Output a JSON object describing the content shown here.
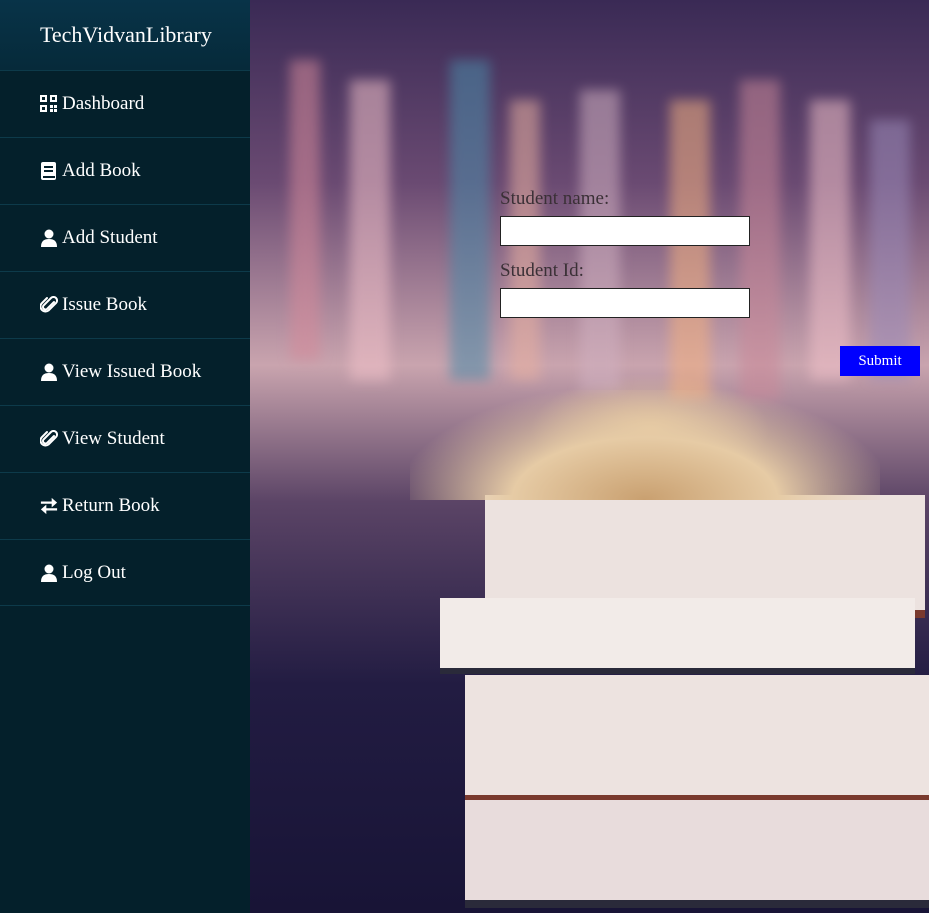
{
  "brand": {
    "title": "TechVidvanLibrary"
  },
  "sidebar": {
    "items": [
      {
        "label": "Dashboard",
        "icon": "dashboard-icon"
      },
      {
        "label": "Add Book",
        "icon": "book-icon"
      },
      {
        "label": "Add Student",
        "icon": "user-icon"
      },
      {
        "label": "Issue Book",
        "icon": "paperclip-icon"
      },
      {
        "label": "View Issued Book",
        "icon": "user-icon"
      },
      {
        "label": "View Student",
        "icon": "paperclip-icon"
      },
      {
        "label": "Return Book",
        "icon": "exchange-icon"
      },
      {
        "label": "Log Out",
        "icon": "user-icon"
      }
    ]
  },
  "form": {
    "student_name_label": "Student name:",
    "student_name_value": "",
    "student_id_label": "Student Id:",
    "student_id_value": "",
    "submit_label": "Submit"
  },
  "colors": {
    "sidebar_bg": "#04202b",
    "brand_bg": "#083348",
    "submit_bg": "#0000ff"
  }
}
